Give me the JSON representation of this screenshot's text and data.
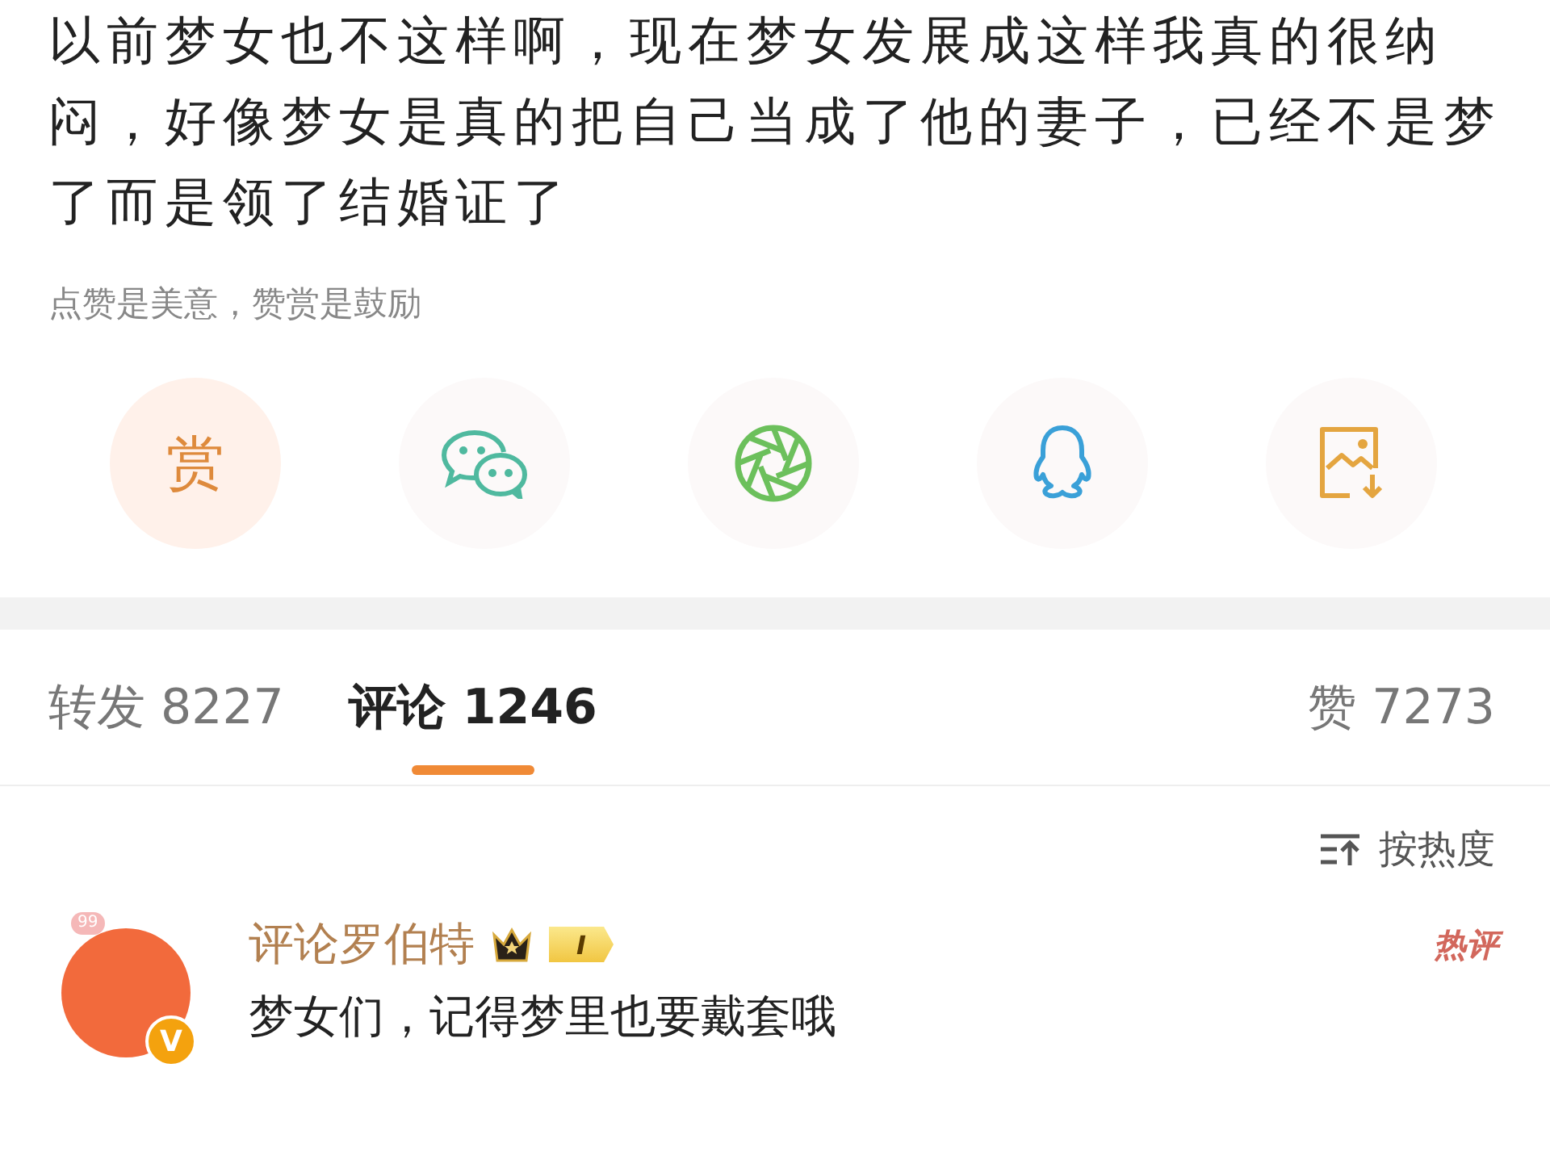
{
  "post": {
    "text": "以前梦女也不这样啊，现在梦女发展成这样我真的很纳闷，好像梦女是真的把自己当成了他的妻子，已经不是梦了而是领了结婚证了"
  },
  "reward_hint": "点赞是美意，赞赏是鼓励",
  "share_actions": [
    {
      "kind": "reward",
      "label": "赏"
    },
    {
      "kind": "wechat"
    },
    {
      "kind": "moments"
    },
    {
      "kind": "qq"
    },
    {
      "kind": "save-image"
    }
  ],
  "tabs": [
    {
      "label": "转发",
      "count": "8227",
      "selected": false
    },
    {
      "label": "评论",
      "count": "1246",
      "selected": true
    }
  ],
  "likes": {
    "label": "赞",
    "count": "7273"
  },
  "sort": {
    "label": "按热度"
  },
  "comments": [
    {
      "avatar_badge": "99",
      "verified_mark": "V",
      "name": "评论罗伯特",
      "level": "I",
      "tag": "热评",
      "text": "梦女们，记得梦里也要戴套哦"
    }
  ]
}
